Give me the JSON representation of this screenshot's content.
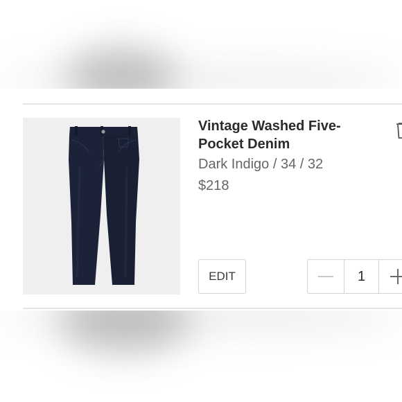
{
  "product": {
    "title": "Vintage Washed Five-Pocket Denim",
    "variant": "Dark Indigo / 34 / 32",
    "price": "$218",
    "image": "dark-indigo-jeans"
  },
  "actions": {
    "edit_label": "EDIT",
    "remove_icon": "trash-icon"
  },
  "quantity": {
    "value": "1",
    "decrement_icon": "minus-icon",
    "increment_icon": "plus-icon"
  },
  "colors": {
    "title": "#2b2b2b",
    "secondary_text": "#666666",
    "border": "#d4d4d4",
    "image_background": "#efefef",
    "denim": "#1c2338"
  }
}
